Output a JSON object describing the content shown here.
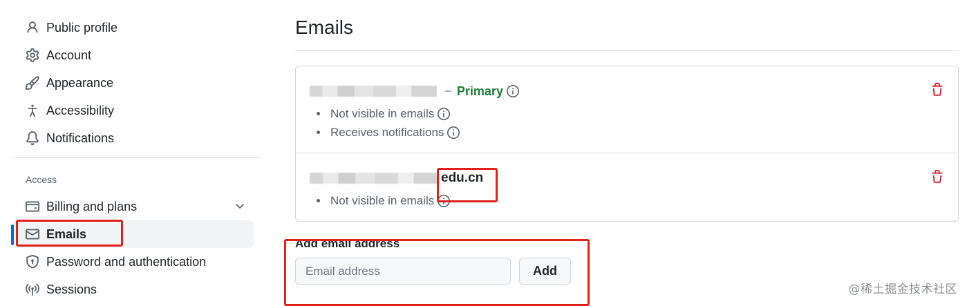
{
  "sidebar": {
    "items": [
      {
        "label": "Public profile",
        "icon": "person-icon"
      },
      {
        "label": "Account",
        "icon": "gear-icon"
      },
      {
        "label": "Appearance",
        "icon": "paintbrush-icon"
      },
      {
        "label": "Accessibility",
        "icon": "accessibility-icon"
      },
      {
        "label": "Notifications",
        "icon": "bell-icon"
      }
    ],
    "access_heading": "Access",
    "access_items": [
      {
        "label": "Billing and plans",
        "icon": "credit-card-icon",
        "expandable": true
      },
      {
        "label": "Emails",
        "icon": "mail-icon",
        "active": true
      },
      {
        "label": "Password and authentication",
        "icon": "shield-lock-icon"
      },
      {
        "label": "Sessions",
        "icon": "broadcast-icon"
      }
    ]
  },
  "main": {
    "title": "Emails",
    "emails": [
      {
        "address_suffix": "",
        "separator": "–",
        "badge": "Primary",
        "notes": [
          "Not visible in emails",
          "Receives notifications"
        ]
      },
      {
        "address_suffix": "edu.cn",
        "notes": [
          "Not visible in emails"
        ]
      }
    ],
    "add": {
      "label": "Add email address",
      "placeholder": "Email address",
      "button": "Add"
    }
  },
  "watermark": "@稀土掘金技术社区",
  "colors": {
    "accent": "#0969da",
    "primary_badge": "#1a7f37",
    "danger": "#cf222e",
    "annotation": "#e0201b"
  }
}
